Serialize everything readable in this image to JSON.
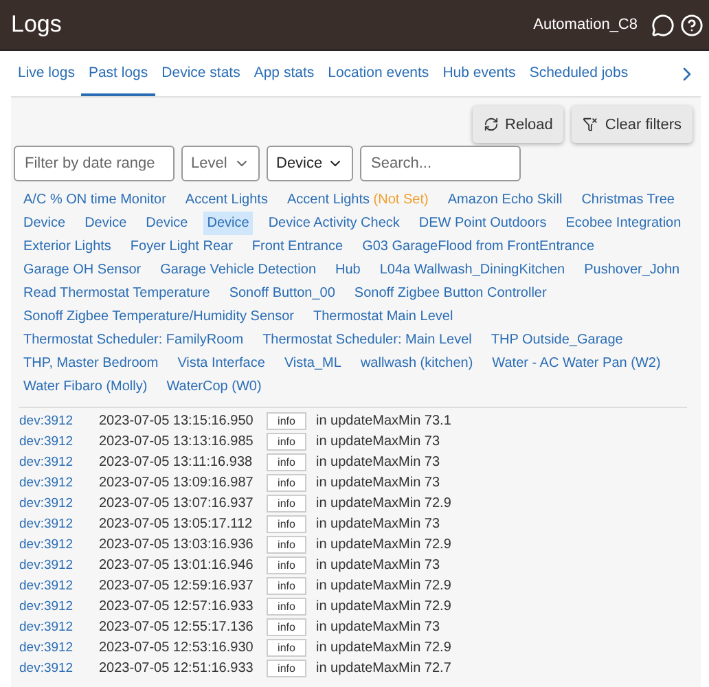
{
  "header": {
    "title": "Logs",
    "hub_name": "Automation_C8"
  },
  "tabs": [
    {
      "label": "Live logs",
      "selected": false
    },
    {
      "label": "Past logs",
      "selected": true
    },
    {
      "label": "Device stats",
      "selected": false
    },
    {
      "label": "App stats",
      "selected": false
    },
    {
      "label": "Location events",
      "selected": false
    },
    {
      "label": "Hub events",
      "selected": false
    },
    {
      "label": "Scheduled jobs",
      "selected": false
    }
  ],
  "actions": [
    {
      "kind": "reload",
      "label": "Reload"
    },
    {
      "kind": "clear",
      "label": "Clear filters"
    }
  ],
  "filters": {
    "date_range": {
      "placeholder": "Filter by date range"
    },
    "level": {
      "placeholder": "Level"
    },
    "device": {
      "value": "Device"
    },
    "search": {
      "placeholder": "Search..."
    }
  },
  "sources": [
    {
      "label": "A/C % ON time Monitor",
      "selected": false
    },
    {
      "label": "Accent Lights",
      "selected": false
    },
    {
      "label": "Accent Lights",
      "note": "(Not Set)",
      "selected": false
    },
    {
      "label": "Amazon Echo Skill",
      "selected": false
    },
    {
      "label": "Christmas Tree",
      "selected": false
    },
    {
      "label": "Device",
      "selected": false
    },
    {
      "label": "Device",
      "selected": false
    },
    {
      "label": "Device",
      "selected": false
    },
    {
      "label": "Device",
      "selected": true
    },
    {
      "label": "Device Activity Check",
      "selected": false
    },
    {
      "label": "DEW Point Outdoors",
      "selected": false
    },
    {
      "label": "Ecobee Integration",
      "selected": false
    },
    {
      "label": "Exterior Lights",
      "selected": false
    },
    {
      "label": "Foyer Light Rear",
      "selected": false
    },
    {
      "label": "Front Entrance",
      "selected": false
    },
    {
      "label": "G03 GarageFlood from FrontEntrance",
      "selected": false
    },
    {
      "label": "Garage OH Sensor",
      "selected": false
    },
    {
      "label": "Garage Vehicle Detection",
      "selected": false
    },
    {
      "label": "Hub",
      "selected": false
    },
    {
      "label": "L04a Wallwash_DiningKitchen",
      "selected": false
    },
    {
      "label": "Pushover_John",
      "selected": false
    },
    {
      "label": "Read Thermostat Temperature",
      "selected": false
    },
    {
      "label": "Sonoff Button_00",
      "selected": false
    },
    {
      "label": "Sonoff Zigbee Button Controller",
      "selected": false
    },
    {
      "label": "Sonoff Zigbee Temperature/Humidity Sensor",
      "selected": false
    },
    {
      "label": "Thermostat Main Level",
      "selected": false
    },
    {
      "label": "Thermostat Scheduler: FamilyRoom",
      "selected": false
    },
    {
      "label": "Thermostat Scheduler: Main Level",
      "selected": false
    },
    {
      "label": "THP Outside_Garage",
      "selected": false
    },
    {
      "label": "THP, Master Bedroom",
      "selected": false
    },
    {
      "label": "Vista Interface",
      "selected": false
    },
    {
      "label": "Vista_ML",
      "selected": false
    },
    {
      "label": "wallwash (kitchen)",
      "selected": false
    },
    {
      "label": "Water - AC Water Pan (W2)",
      "selected": false
    },
    {
      "label": "Water Fibaro (Molly)",
      "selected": false
    },
    {
      "label": "WaterCop (W0)",
      "selected": false
    }
  ],
  "log_rows": [
    {
      "source": "dev:3912",
      "time": "2023-07-05 13:15:16.950",
      "level": "info",
      "message": "in updateMaxMin 73.1"
    },
    {
      "source": "dev:3912",
      "time": "2023-07-05 13:13:16.985",
      "level": "info",
      "message": "in updateMaxMin 73"
    },
    {
      "source": "dev:3912",
      "time": "2023-07-05 13:11:16.938",
      "level": "info",
      "message": "in updateMaxMin 73"
    },
    {
      "source": "dev:3912",
      "time": "2023-07-05 13:09:16.987",
      "level": "info",
      "message": "in updateMaxMin 73"
    },
    {
      "source": "dev:3912",
      "time": "2023-07-05 13:07:16.937",
      "level": "info",
      "message": "in updateMaxMin 72.9"
    },
    {
      "source": "dev:3912",
      "time": "2023-07-05 13:05:17.112",
      "level": "info",
      "message": "in updateMaxMin 73"
    },
    {
      "source": "dev:3912",
      "time": "2023-07-05 13:03:16.936",
      "level": "info",
      "message": "in updateMaxMin 72.9"
    },
    {
      "source": "dev:3912",
      "time": "2023-07-05 13:01:16.946",
      "level": "info",
      "message": "in updateMaxMin 73"
    },
    {
      "source": "dev:3912",
      "time": "2023-07-05 12:59:16.937",
      "level": "info",
      "message": "in updateMaxMin 72.9"
    },
    {
      "source": "dev:3912",
      "time": "2023-07-05 12:57:16.933",
      "level": "info",
      "message": "in updateMaxMin 72.9"
    },
    {
      "source": "dev:3912",
      "time": "2023-07-05 12:55:17.136",
      "level": "info",
      "message": "in updateMaxMin 73"
    },
    {
      "source": "dev:3912",
      "time": "2023-07-05 12:53:16.930",
      "level": "info",
      "message": "in updateMaxMin 72.9"
    },
    {
      "source": "dev:3912",
      "time": "2023-07-05 12:51:16.933",
      "level": "info",
      "message": "in updateMaxMin 72.7"
    }
  ]
}
